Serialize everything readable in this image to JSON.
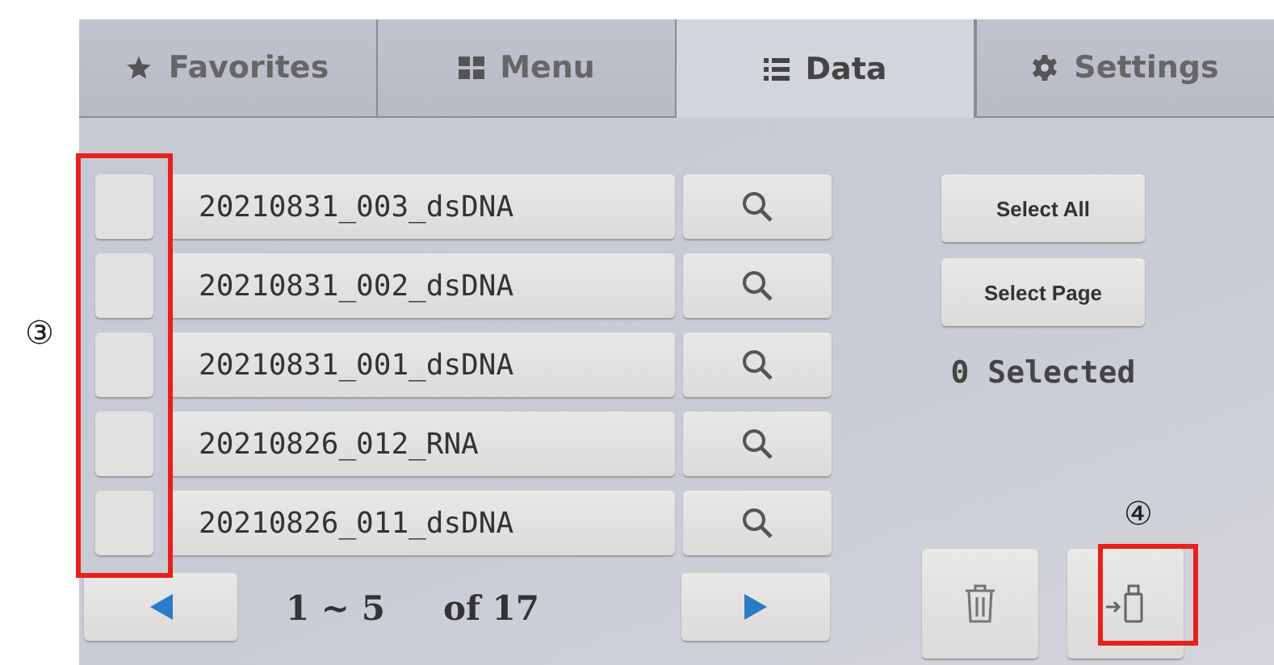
{
  "tabs": [
    {
      "label": "Favorites",
      "selected": false
    },
    {
      "label": "Menu",
      "selected": false
    },
    {
      "label": "Data",
      "selected": true
    },
    {
      "label": "Settings",
      "selected": false
    }
  ],
  "rows": [
    {
      "name": "20210831_003_dsDNA",
      "checked": false
    },
    {
      "name": "20210831_002_dsDNA",
      "checked": false
    },
    {
      "name": "20210831_001_dsDNA",
      "checked": false
    },
    {
      "name": "20210826_012_RNA",
      "checked": false
    },
    {
      "name": "20210826_011_dsDNA",
      "checked": false
    }
  ],
  "pagination": {
    "range": "1 ~ 5",
    "total": "of 17"
  },
  "side": {
    "select_all": "Select All",
    "select_page": "Select Page",
    "selected_count": "0 Selected"
  },
  "annotations": [
    {
      "label": "③"
    },
    {
      "label": "④"
    }
  ]
}
